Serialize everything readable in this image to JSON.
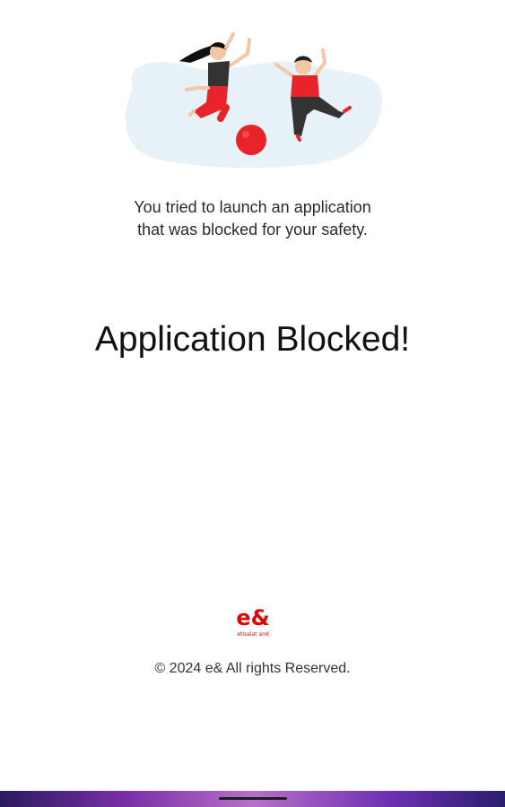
{
  "message": {
    "line1": "You tried to launch an application",
    "line2": "that was blocked for your safety."
  },
  "title": "Application Blocked!",
  "brand": {
    "logo_mark": "e&",
    "logo_caption": "etisalat and",
    "color": "#e00000"
  },
  "footer": {
    "copyright": "© 2024 e& All rights Reserved."
  },
  "colors": {
    "accent_red": "#e8242a",
    "blob": "#e6f1f8"
  },
  "icons": {
    "illustration": "kids-playing-illustration",
    "logo": "etisalat-and-logo"
  }
}
